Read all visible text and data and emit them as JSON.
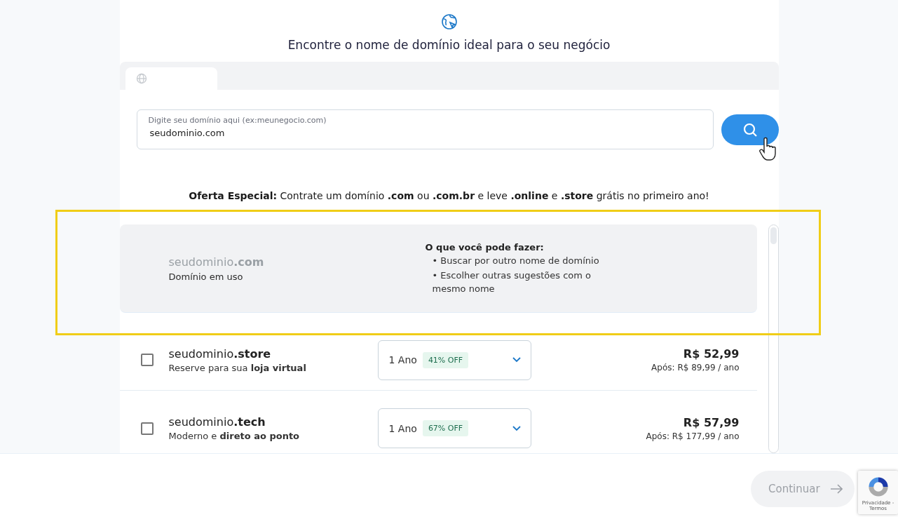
{
  "header": {
    "title": "Encontre o nome de domínio ideal para o seu negócio"
  },
  "tabs": [
    {
      "selected": true
    }
  ],
  "search": {
    "label": "Digite seu domínio aqui (ex:meunegocio.com)",
    "value": "seudominio.com"
  },
  "offer": "**Oferta Especial:** Contrate um domínio **.com** ou **.com.br** e leve **.online** e **.store** grátis no primeiro ano!",
  "used_domain": {
    "name": "seudominio**.com**",
    "status": "Domínio em uso",
    "highlighted": true,
    "tips_title": "O que você pode fazer:",
    "tips": [
      "• Buscar por outro nome de domínio",
      "• Escolher outras sugestões com o mesmo nome"
    ]
  },
  "domains": [
    {
      "name": "seudominio**.store**",
      "description": "Reserve para sua **loja virtual**",
      "checked": false,
      "period": "1 Ano",
      "discount": "41% OFF",
      "price": "R$ 52,99",
      "after": "Após: R$ 89,99 / ano"
    },
    {
      "name": "seudominio**.tech**",
      "description": "Moderno e **direto ao ponto**",
      "checked": false,
      "period": "1 Ano",
      "discount": "67% OFF",
      "price": "R$ 57,99",
      "after": "Após: R$ 177,99 / ano"
    }
  ],
  "footer": {
    "button": "Continuar",
    "disabled": true,
    "recaptcha": "Privacidade - Termos"
  }
}
